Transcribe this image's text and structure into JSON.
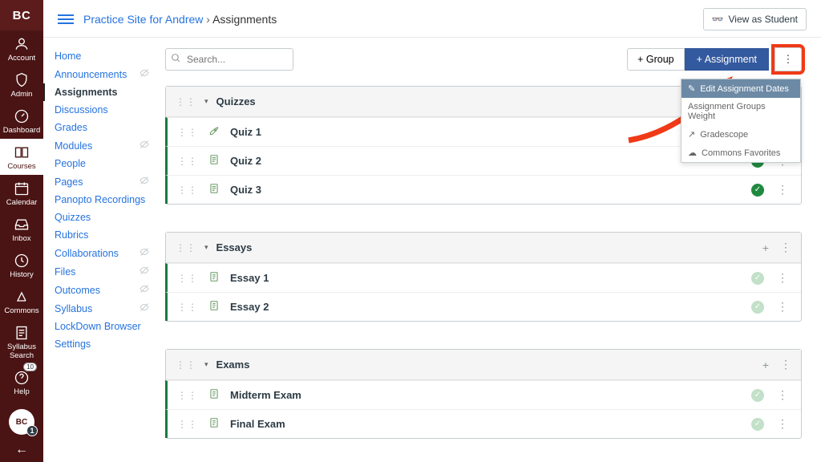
{
  "brand": "BC",
  "globalNav": [
    {
      "label": "Account",
      "icon": "account"
    },
    {
      "label": "Admin",
      "icon": "admin"
    },
    {
      "label": "Dashboard",
      "icon": "dashboard"
    },
    {
      "label": "Courses",
      "icon": "courses",
      "active": true
    },
    {
      "label": "Calendar",
      "icon": "calendar"
    },
    {
      "label": "Inbox",
      "icon": "inbox"
    },
    {
      "label": "History",
      "icon": "history"
    },
    {
      "label": "Commons",
      "icon": "commons"
    },
    {
      "label": "Syllabus Search",
      "icon": "syllabus"
    },
    {
      "label": "Help",
      "icon": "help",
      "badge": "10"
    }
  ],
  "avatarBadge": "1",
  "breadcrumb": {
    "course": "Practice Site for Andrew",
    "page": "Assignments"
  },
  "viewAsStudent": "View as Student",
  "courseNav": [
    {
      "label": "Home"
    },
    {
      "label": "Announcements",
      "hidden": true
    },
    {
      "label": "Assignments",
      "active": true
    },
    {
      "label": "Discussions"
    },
    {
      "label": "Grades"
    },
    {
      "label": "Modules",
      "hidden": true
    },
    {
      "label": "People"
    },
    {
      "label": "Pages",
      "hidden": true
    },
    {
      "label": "Panopto Recordings"
    },
    {
      "label": "Quizzes"
    },
    {
      "label": "Rubrics"
    },
    {
      "label": "Collaborations",
      "hidden": true
    },
    {
      "label": "Files",
      "hidden": true
    },
    {
      "label": "Outcomes",
      "hidden": true
    },
    {
      "label": "Syllabus",
      "hidden": true
    },
    {
      "label": "LockDown Browser"
    },
    {
      "label": "Settings"
    }
  ],
  "search": {
    "placeholder": "Search..."
  },
  "buttons": {
    "group": "+ Group",
    "assignment": "+ Assignment"
  },
  "menu": {
    "editDates": "Edit Assignment Dates",
    "weights": "Assignment Groups Weight",
    "gradescope": "Gradescope",
    "commons": "Commons Favorites"
  },
  "groups": [
    {
      "title": "Quizzes",
      "showAdd": false,
      "items": [
        {
          "title": "Quiz 1",
          "icon": "rocket",
          "published": true
        },
        {
          "title": "Quiz 2",
          "icon": "quiz",
          "published": true
        },
        {
          "title": "Quiz 3",
          "icon": "quiz",
          "published": true
        }
      ]
    },
    {
      "title": "Essays",
      "showAdd": true,
      "items": [
        {
          "title": "Essay 1",
          "icon": "assign",
          "published": false
        },
        {
          "title": "Essay 2",
          "icon": "assign",
          "published": false
        }
      ]
    },
    {
      "title": "Exams",
      "showAdd": true,
      "items": [
        {
          "title": "Midterm Exam",
          "icon": "assign",
          "published": false
        },
        {
          "title": "Final Exam",
          "icon": "assign",
          "published": false
        }
      ]
    }
  ]
}
